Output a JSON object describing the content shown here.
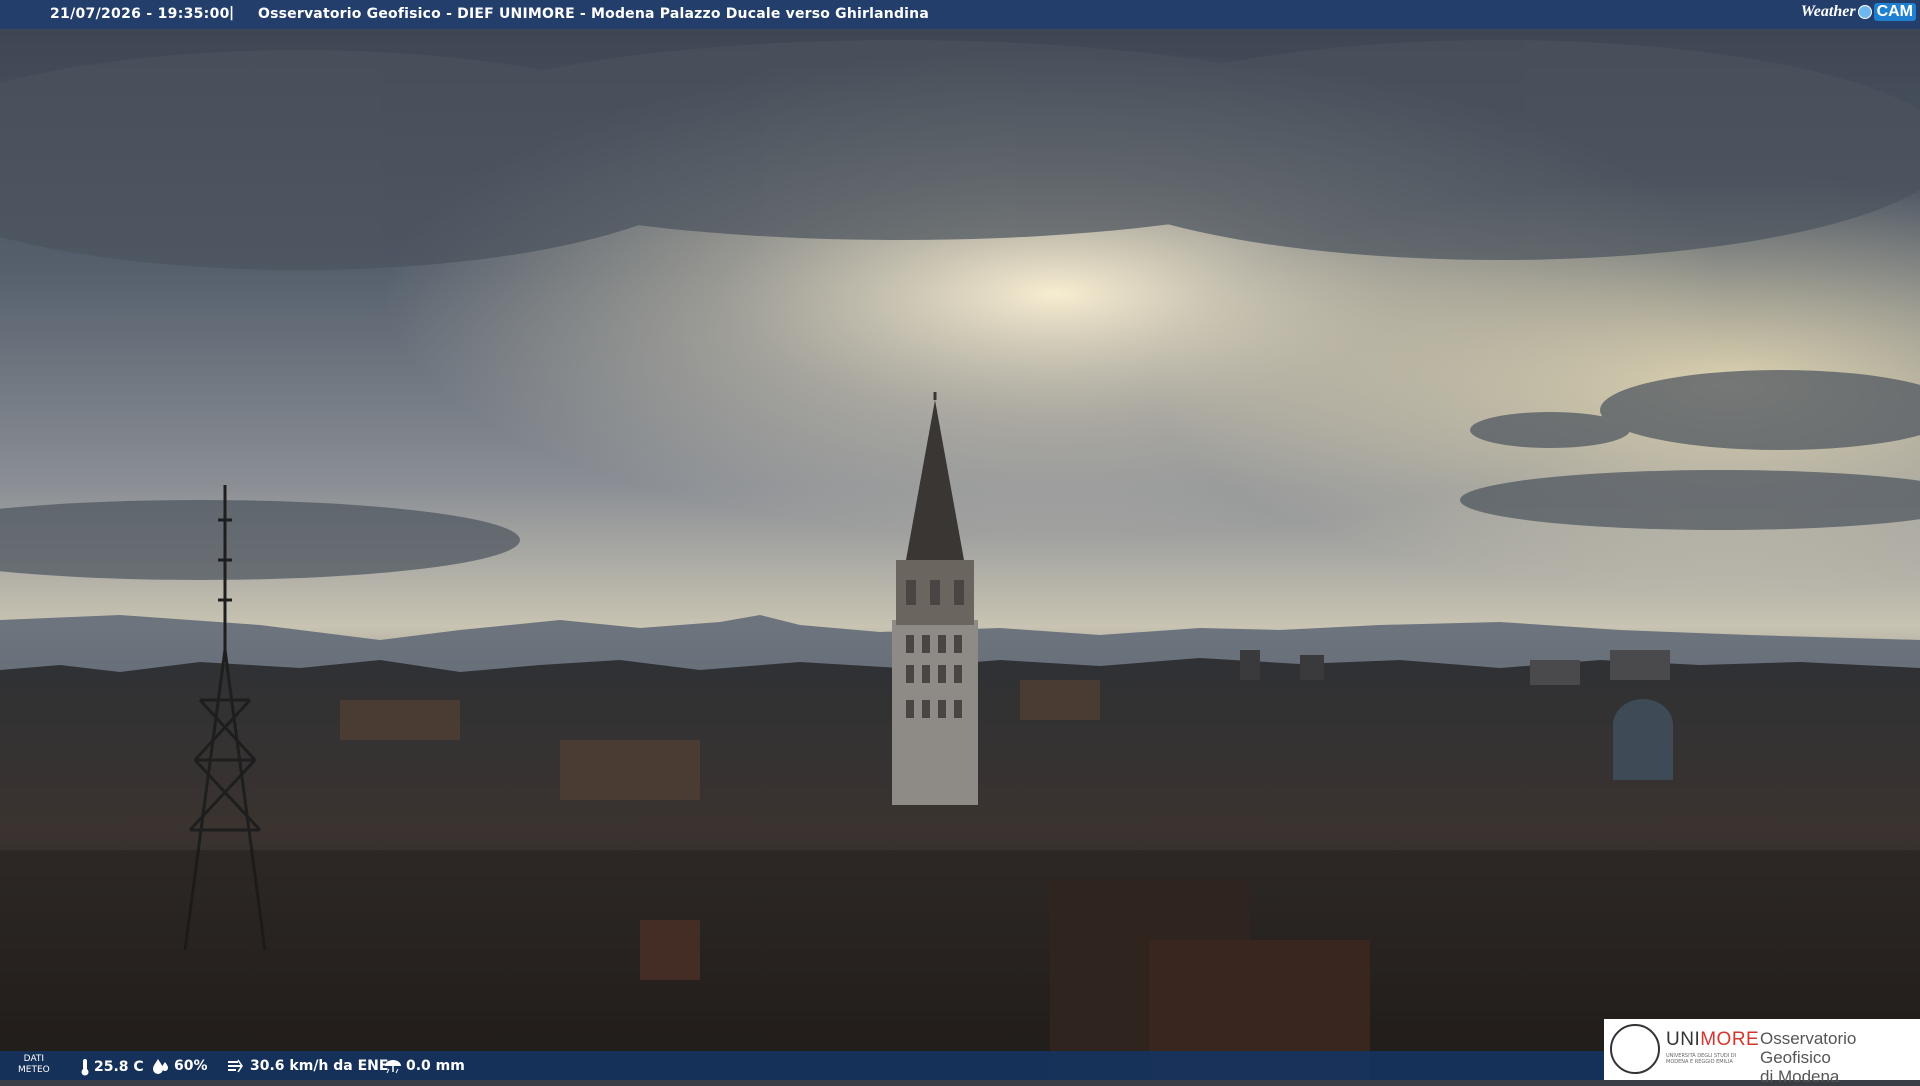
{
  "header": {
    "timestamp": "21/07/2026 - 19:35:00",
    "separator": "|",
    "caption": "Osservatorio Geofisico - DIEF UNIMORE - Modena Palazzo Ducale verso Ghirlandina",
    "brand_weather": "Weather",
    "brand_cam": "CAM"
  },
  "footer": {
    "dati_label_1": "DATI",
    "dati_label_2": "METEO",
    "temperature": "25.8 C",
    "humidity": "60%",
    "wind": "30.6 km/h da ENE",
    "rain": "0.0 mm",
    "icons": [
      "thermometer-icon",
      "humidity-icon",
      "wind-icon",
      "rain-icon"
    ]
  },
  "logo": {
    "uni_prefix": "UNI",
    "uni_suffix": "MORE",
    "uni_subtitle": "UNIVERSITÀ DEGLI STUDI DI MODENA E REGGIO EMILIA",
    "observatory_line1": "Osservatorio Geofisico",
    "observatory_line2": "di Modena"
  },
  "colors": {
    "bar_blue": "#203e6e",
    "unimore_red": "#d4352e",
    "sky_light": "#f3e7c4",
    "sky_dark": "#3f4a58"
  }
}
